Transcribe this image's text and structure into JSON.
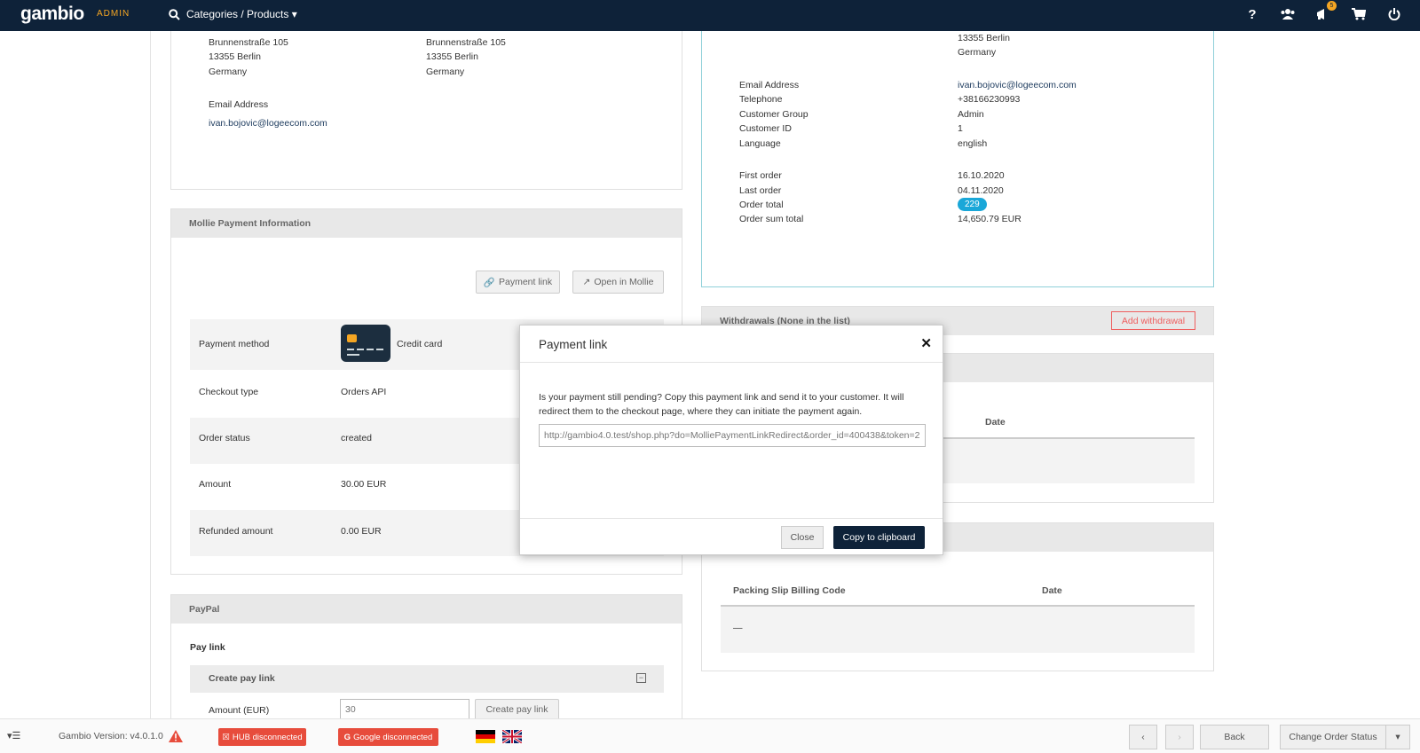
{
  "topbar": {
    "logo": "gambio",
    "admin_tag": "ADMIN",
    "category_nav": "Categories / Products ▾",
    "notifications_count": "5",
    "icons": [
      "help-icon",
      "customers-icon",
      "megaphone-icon",
      "cart-icon",
      "power-icon"
    ]
  },
  "address_panel": {
    "billing": {
      "street": "Brunnenstraße 105",
      "city": "13355 Berlin",
      "country": "Germany"
    },
    "shipping": {
      "street": "Brunnenstraße 105",
      "city": "13355 Berlin",
      "country": "Germany"
    },
    "email_label": "Email Address",
    "email_value": "ivan.bojovic@logeecom.com"
  },
  "mollie": {
    "header": "Mollie Payment Information",
    "payment_link_btn": "Payment link",
    "open_mollie_btn": "Open in Mollie",
    "rows": [
      {
        "label": "Payment method",
        "value": "Credit card"
      },
      {
        "label": "Checkout type",
        "value": "Orders API"
      },
      {
        "label": "Order status",
        "value": "created"
      },
      {
        "label": "Amount",
        "value": "30.00 EUR"
      },
      {
        "label": "Refunded amount",
        "value": "0.00 EUR"
      }
    ]
  },
  "paypal": {
    "header": "PayPal",
    "pay_link_title": "Pay link",
    "create_pay_link_header": "Create pay link",
    "amount_label": "Amount (EUR)",
    "amount_placeholder": "30",
    "create_btn": "Create pay link"
  },
  "customer": {
    "city": "13355 Berlin",
    "country": "Germany",
    "rows1": [
      {
        "label": "Email Address",
        "value": "ivan.bojovic@logeecom.com"
      },
      {
        "label": "Telephone",
        "value": "+38166230993"
      },
      {
        "label": "Customer Group",
        "value": "Admin"
      },
      {
        "label": "Customer ID",
        "value": "1"
      },
      {
        "label": "Language",
        "value": "english"
      }
    ],
    "first_order_label": "First order",
    "first_order_value": "16.10.2020",
    "last_order_label": "Last order",
    "last_order_value": "04.11.2020",
    "order_total_label": "Order total",
    "order_total_value": "229",
    "order_sum_label": "Order sum total",
    "order_sum_value": "14,650.79 EUR"
  },
  "withdrawals": {
    "header": "Withdrawals (None in the list)",
    "add_btn": "Add withdrawal"
  },
  "invoices": {
    "date_col": "Date"
  },
  "packing": {
    "code_col": "Packing Slip Billing Code",
    "date_col": "Date",
    "empty": "—"
  },
  "modal": {
    "title": "Payment link",
    "body": "Is your payment still pending? Copy this payment link and send it to your customer. It will redirect them to the checkout page, where they can initiate the payment again.",
    "link_value": "http://gambio4.0.test/shop.php?do=MolliePaymentLinkRedirect&order_id=400438&token=2",
    "close_btn": "Close",
    "copy_btn": "Copy to clipboard"
  },
  "footer": {
    "version": "Gambio Version: v4.0.1.0",
    "hub": "HUB disconnected",
    "google": "Google disconnected",
    "back_btn": "Back",
    "change_status_btn": "Change Order Status"
  }
}
